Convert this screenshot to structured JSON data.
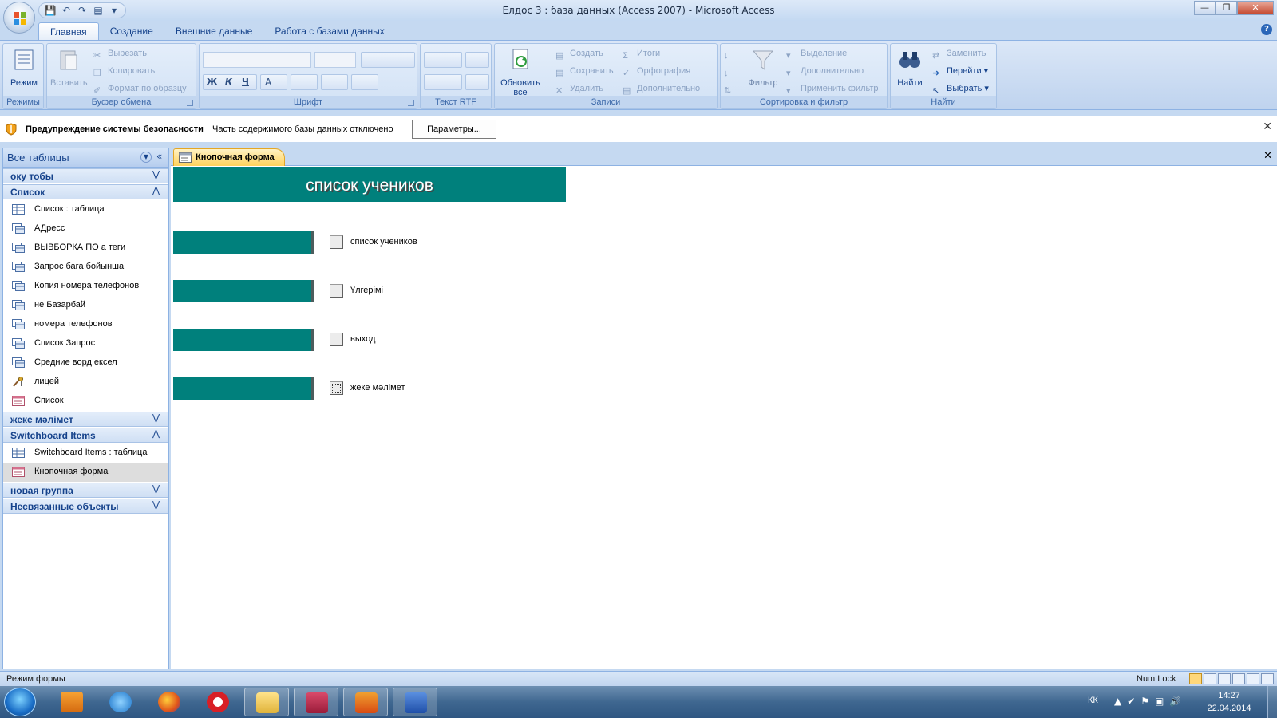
{
  "window": {
    "title": "Елдос 3 : база данных (Access 2007) - Microsoft Access",
    "controls": [
      "minimize",
      "maximize",
      "close"
    ]
  },
  "qat": {
    "items": [
      "save-icon",
      "undo-icon",
      "redo-icon",
      "view-icon",
      "customize-icon"
    ]
  },
  "ribbon": {
    "tabs": [
      {
        "label": "Главная",
        "active": true
      },
      {
        "label": "Создание"
      },
      {
        "label": "Внешние данные"
      },
      {
        "label": "Работа с базами данных"
      }
    ],
    "groups": {
      "views": {
        "label": "Режимы",
        "mode": "Режим"
      },
      "clipboard": {
        "label": "Буфер обмена",
        "paste": "Вставить",
        "cut": "Вырезать",
        "copy": "Копировать",
        "format_painter": "Формат по образцу"
      },
      "font": {
        "label": "Шрифт",
        "bold": "Ж",
        "italic": "К",
        "underline": "Ч",
        "font_color": "А"
      },
      "rtf": {
        "label": "Текст RTF"
      },
      "records": {
        "label": "Записи",
        "refresh_line1": "Обновить",
        "refresh_line2": "все",
        "create": "Создать",
        "save": "Сохранить",
        "delete": "Удалить",
        "totals": "Итоги",
        "spelling": "Орфография",
        "more": "Дополнительно"
      },
      "sort_filter": {
        "label": "Сортировка и фильтр",
        "filter": "Фильтр",
        "selection": "Выделение",
        "advanced": "Дополнительно",
        "apply_filter": "Применить фильтр"
      },
      "find": {
        "label": "Найти",
        "find": "Найти",
        "replace": "Заменить",
        "goto": "Перейти",
        "select": "Выбрать"
      }
    }
  },
  "security_bar": {
    "title": "Предупреждение системы безопасности",
    "message": "Часть содержимого базы данных отключено",
    "button": "Параметры..."
  },
  "nav_pane": {
    "header": "Все таблицы",
    "groups": [
      {
        "title": "оку тобы",
        "expanded": false,
        "items": []
      },
      {
        "title": "Список",
        "expanded": true,
        "items": [
          {
            "label": "Список : таблица",
            "icon": "table-icon"
          },
          {
            "label": "АДресс",
            "icon": "query-icon"
          },
          {
            "label": "ВЫВБОРКА  ПО а теги",
            "icon": "query-icon"
          },
          {
            "label": "Запрос бага бойынша",
            "icon": "query-icon"
          },
          {
            "label": "Копия номера телефонов",
            "icon": "query-icon"
          },
          {
            "label": "не Базарбай",
            "icon": "query-icon"
          },
          {
            "label": "номера телефонов",
            "icon": "query-icon"
          },
          {
            "label": "Список Запрос",
            "icon": "query-icon"
          },
          {
            "label": "Средние ворд ексел",
            "icon": "query-icon"
          },
          {
            "label": "лицей",
            "icon": "macro-icon"
          },
          {
            "label": "Список",
            "icon": "form-icon"
          }
        ]
      },
      {
        "title": "жеке мәлімет",
        "expanded": false,
        "items": []
      },
      {
        "title": "Switchboard Items",
        "expanded": true,
        "items": [
          {
            "label": "Switchboard Items : таблица",
            "icon": "table-icon"
          },
          {
            "label": "Кнопочная форма",
            "icon": "form-icon",
            "selected": true
          }
        ]
      },
      {
        "title": "новая группа",
        "expanded": false,
        "items": []
      },
      {
        "title": "Несвязанные объекты",
        "expanded": false,
        "items": []
      }
    ]
  },
  "document": {
    "tab_label": "Кнопочная форма",
    "form_title": "список учеников",
    "buttons": [
      {
        "label": "список учеников"
      },
      {
        "label": "Үлгерімі"
      },
      {
        "label": "выход"
      },
      {
        "label": "жеке мәлімет",
        "focused": true
      }
    ]
  },
  "status_bar": {
    "mode": "Режим формы",
    "num_lock": "Num Lock"
  },
  "taskbar": {
    "apps": [
      "media-player-icon",
      "internet-explorer-icon",
      "firefox-icon",
      "opera-icon",
      "explorer-folder-icon",
      "access-icon",
      "kaspersky-icon",
      "word-icon"
    ],
    "lang": "КК",
    "time": "14:27",
    "date": "22.04.2014"
  },
  "colors": {
    "teal": "#00807c",
    "ribbon_bg": "#c5d9f1",
    "accent_tab": "#ffd25c"
  }
}
